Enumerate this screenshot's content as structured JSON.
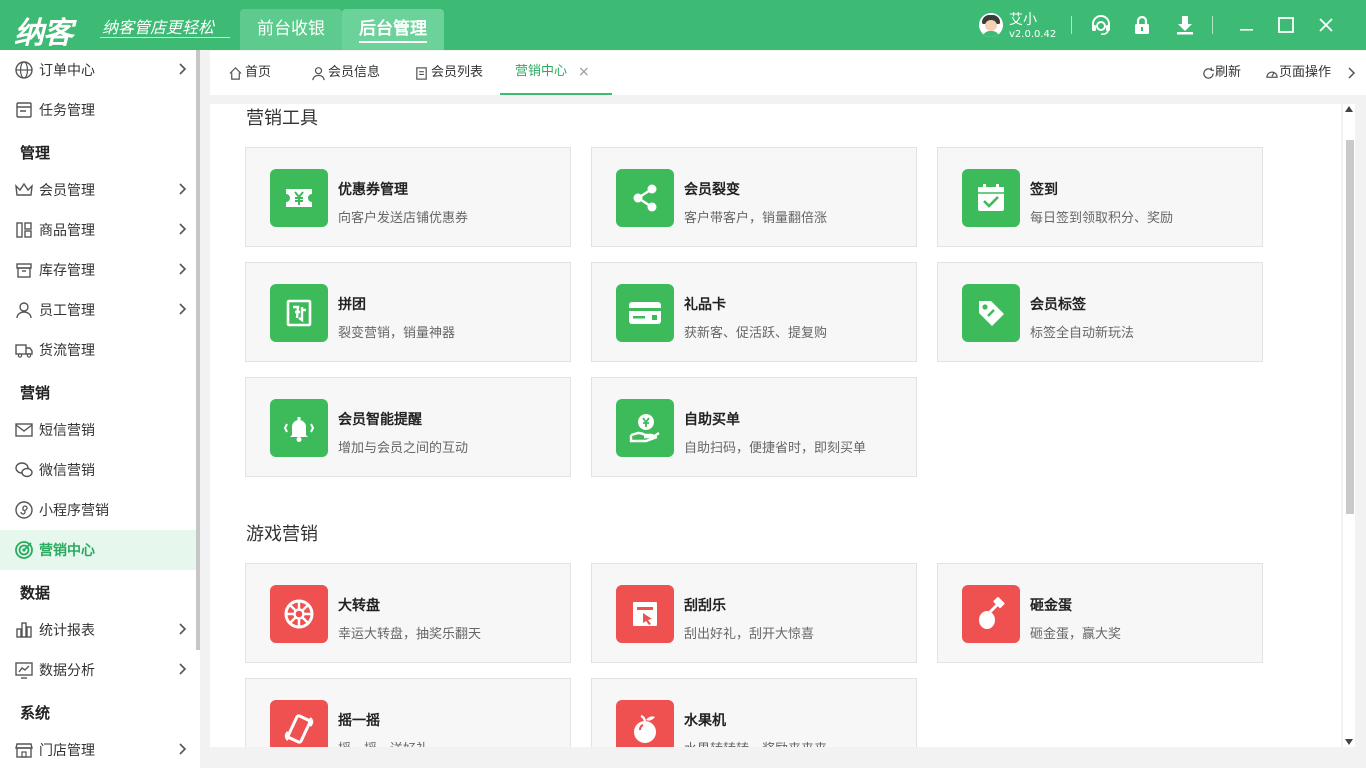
{
  "titlebar": {
    "logo": "纳客",
    "slogan": "纳客管店更轻松",
    "tabs": [
      {
        "label": "前台收银"
      },
      {
        "label": "后台管理"
      }
    ],
    "user_name": "艾小",
    "version": "v2.0.0.42",
    "bg_color": "#3dbb74"
  },
  "sidebar": {
    "items": [
      {
        "label": "订单中心",
        "icon": "globe-icon"
      },
      {
        "label": "任务管理",
        "icon": "task-icon"
      },
      {
        "section": "管理"
      },
      {
        "label": "会员管理",
        "icon": "crown-icon"
      },
      {
        "label": "商品管理",
        "icon": "goods-icon"
      },
      {
        "label": "库存管理",
        "icon": "inventory-icon"
      },
      {
        "label": "员工管理",
        "icon": "person-icon"
      },
      {
        "label": "货流管理",
        "icon": "truck-icon"
      },
      {
        "section": "营销"
      },
      {
        "label": "短信营销",
        "icon": "mail-icon"
      },
      {
        "label": "微信营销",
        "icon": "wechat-icon"
      },
      {
        "label": "小程序营销",
        "icon": "miniapp-icon"
      },
      {
        "label": "营销中心",
        "icon": "target-icon"
      },
      {
        "section": "数据"
      },
      {
        "label": "统计报表",
        "icon": "bar-chart-icon"
      },
      {
        "label": "数据分析",
        "icon": "line-chart-icon"
      },
      {
        "section": "系统"
      },
      {
        "label": "门店管理",
        "icon": "store-icon"
      }
    ],
    "active_color": "#2aab5f"
  },
  "tabbar": {
    "tabs": [
      {
        "label": "首页"
      },
      {
        "label": "会员信息"
      },
      {
        "label": "会员列表"
      },
      {
        "label": "营销中心"
      }
    ],
    "close_glyph": "×",
    "refresh": "刷新",
    "page_ops": "页面操作"
  },
  "main": {
    "sections": [
      {
        "title": "营销工具",
        "cards": [
          {
            "title": "优惠券管理",
            "desc": "向客户发送店铺优惠券",
            "icon": "coupon-icon"
          },
          {
            "title": "会员裂变",
            "desc": "客户带客户，销量翻倍涨",
            "icon": "share-icon"
          },
          {
            "title": "签到",
            "desc": "每日签到领取积分、奖励",
            "icon": "calendar-check-icon"
          },
          {
            "title": "拼团",
            "desc": "裂变营销，销量神器",
            "icon": "group-buy-icon"
          },
          {
            "title": "礼品卡",
            "desc": "获新客、促活跃、提复购",
            "icon": "gift-card-icon"
          },
          {
            "title": "会员标签",
            "desc": "标签全自动新玩法",
            "icon": "tag-icon"
          },
          {
            "title": "会员智能提醒",
            "desc": "增加与会员之间的互动",
            "icon": "bell-icon"
          },
          {
            "title": "自助买单",
            "desc": "自助扫码，便捷省时，即刻买单",
            "icon": "self-pay-icon"
          }
        ]
      },
      {
        "title": "游戏营销",
        "cards": [
          {
            "title": "大转盘",
            "desc": "幸运大转盘，抽奖乐翻天",
            "icon": "wheel-icon"
          },
          {
            "title": "刮刮乐",
            "desc": "刮出好礼，刮开大惊喜",
            "icon": "scratch-card-icon"
          },
          {
            "title": "砸金蛋",
            "desc": "砸金蛋，赢大奖",
            "icon": "golden-egg-icon"
          },
          {
            "title": "摇一摇",
            "desc": "摇一摇，送好礼",
            "icon": "shake-icon"
          },
          {
            "title": "水果机",
            "desc": "水果转转转，奖励来来来",
            "icon": "fruit-machine-icon"
          }
        ]
      }
    ],
    "tool_icon_color": "#3dbb5b",
    "game_icon_color": "#ef5151"
  }
}
